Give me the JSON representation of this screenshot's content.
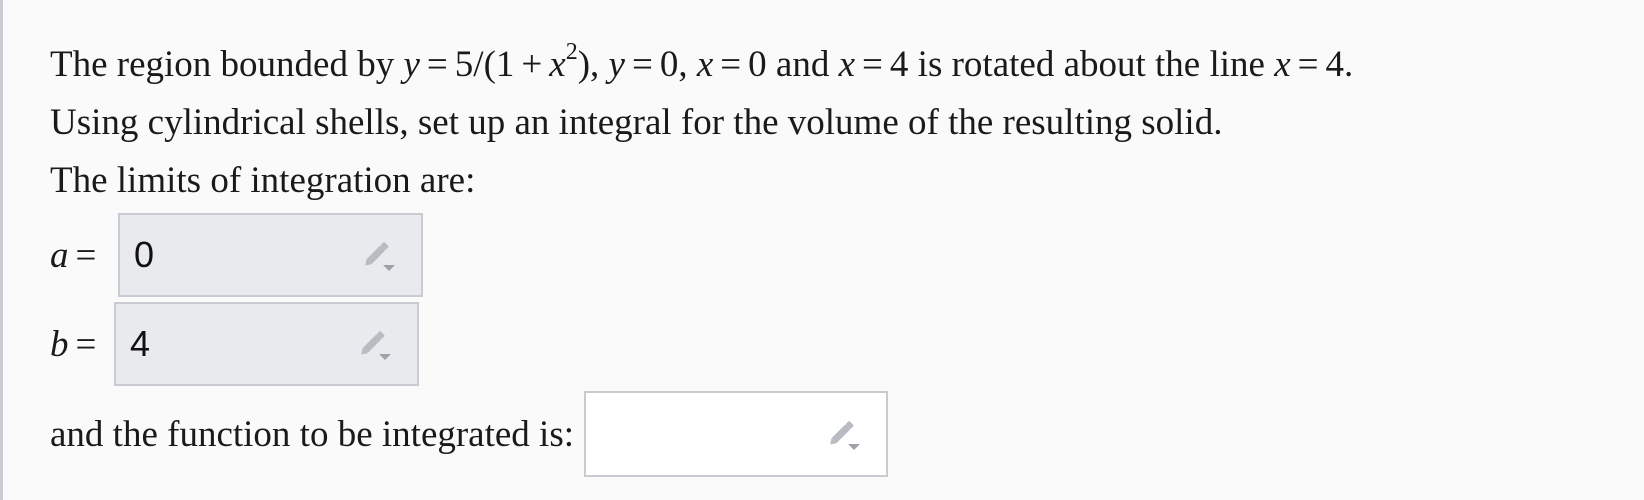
{
  "problem": {
    "line1": {
      "t1": "The region bounded by",
      "t2": "and",
      "t3": "is rotated about the line",
      "t4": "."
    },
    "line2": "Using cylindrical shells, set up an integral for the volume of the resulting solid.",
    "line3": "The limits of integration are:"
  },
  "math": {
    "y": "y",
    "eq": "=",
    "five_over": "5/(1",
    "plus": "+",
    "x": "x",
    "exp": "2",
    "close": "),",
    "zero": "0",
    "comma": ",",
    "four": "4"
  },
  "limits": {
    "a_label": "a",
    "a_value": "0",
    "b_label": "b",
    "b_value": "4"
  },
  "function_prompt": "and the function to be integrated is:",
  "function_value": "",
  "icons": {
    "edit": "pencil-dropdown-icon"
  },
  "colors": {
    "filled_box_bg": "#e9eaee",
    "box_border": "#c8cbd1",
    "icon_gray": "#b8bbc2"
  }
}
